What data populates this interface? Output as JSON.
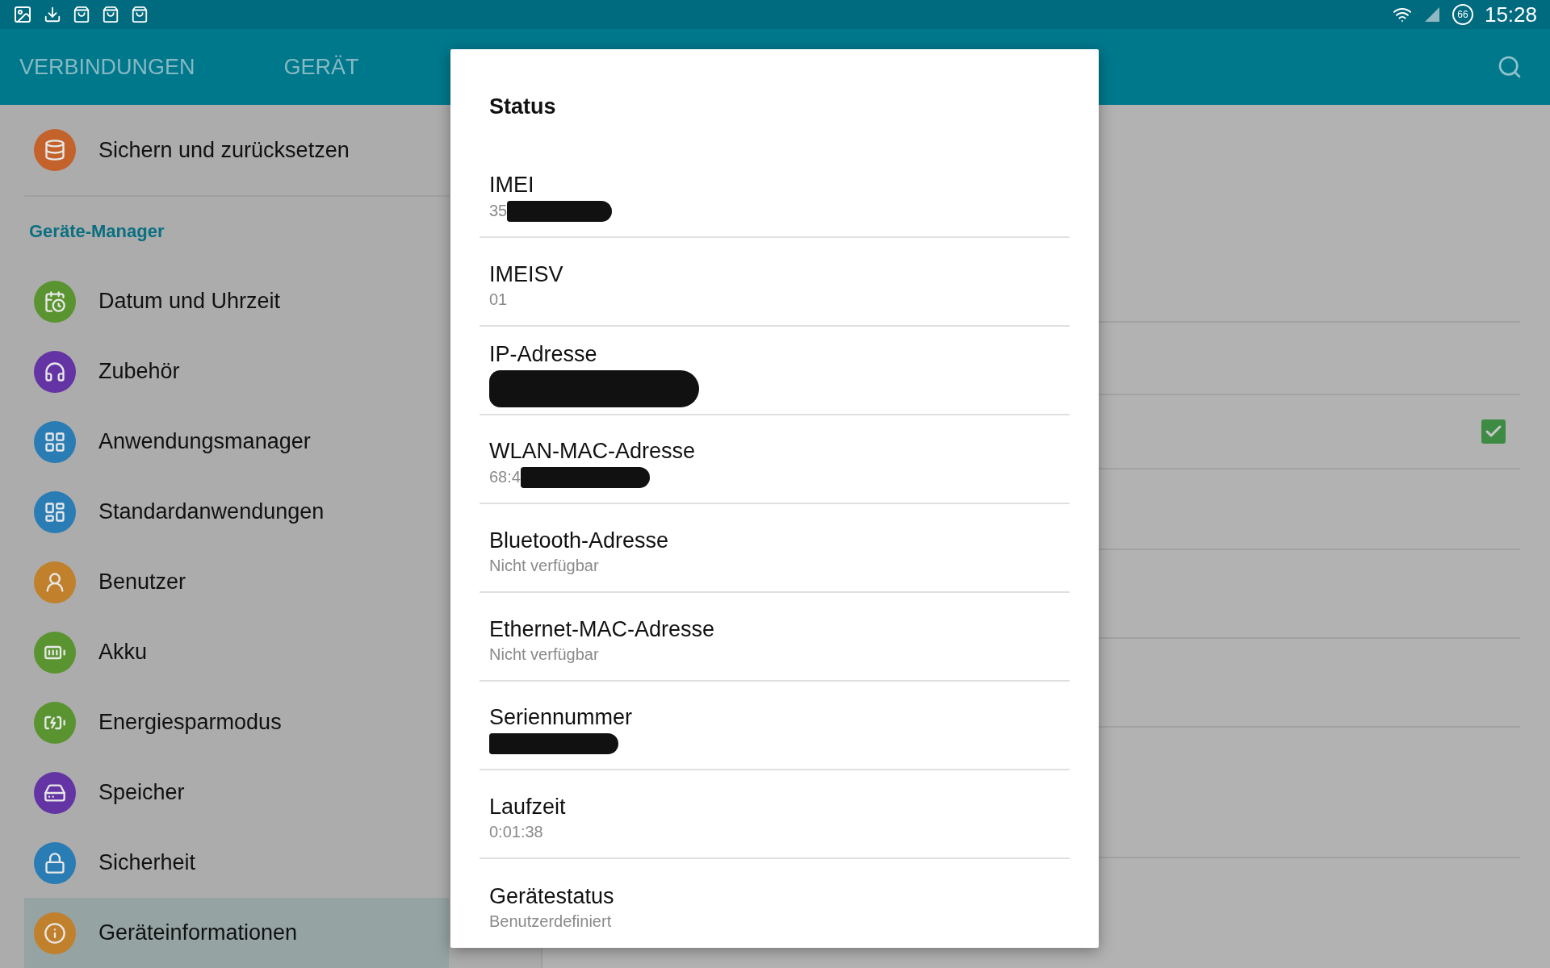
{
  "status_bar": {
    "battery": "66",
    "time": "15:28"
  },
  "tabs": [
    "VERBINDUNGEN",
    "GERÄT"
  ],
  "settings_list": [
    {
      "kind": "item",
      "label": "Sichern und zurücksetzen",
      "color": "#c4622c",
      "selected": false
    },
    {
      "kind": "header",
      "label": "Geräte-Manager"
    },
    {
      "kind": "item",
      "label": "Datum und Uhrzeit",
      "color": "#5a9430",
      "selected": false
    },
    {
      "kind": "item",
      "label": "Zubehör",
      "color": "#6434a4",
      "selected": false
    },
    {
      "kind": "item",
      "label": "Anwendungsmanager",
      "color": "#2a7cb4",
      "selected": false
    },
    {
      "kind": "item",
      "label": "Standardanwendungen",
      "color": "#2a7cb4",
      "selected": false
    },
    {
      "kind": "item",
      "label": "Benutzer",
      "color": "#c0802c",
      "selected": false
    },
    {
      "kind": "item",
      "label": "Akku",
      "color": "#5a9430",
      "selected": false
    },
    {
      "kind": "item",
      "label": "Energiesparmodus",
      "color": "#5a9430",
      "selected": false
    },
    {
      "kind": "item",
      "label": "Speicher",
      "color": "#6434a4",
      "selected": false
    },
    {
      "kind": "item",
      "label": "Sicherheit",
      "color": "#2a7cb4",
      "selected": false
    },
    {
      "kind": "item",
      "label": "Geräteinformationen",
      "color": "#c0802c",
      "selected": true
    }
  ],
  "settings_checkbox": {
    "checked": true
  },
  "dialog": {
    "title": "Status",
    "rows": [
      {
        "label": "IMEI",
        "value": "35",
        "redacted": true
      },
      {
        "label": "IMEISV",
        "value": "01",
        "redacted": false
      },
      {
        "label": "IP-Adresse",
        "redacted": true,
        "tall": true
      },
      {
        "label": "WLAN-MAC-Adresse",
        "value": "68:4",
        "redacted": true
      },
      {
        "label": "Bluetooth-Adresse",
        "value": "Nicht verfügbar",
        "redacted": false
      },
      {
        "label": "Ethernet-MAC-Adresse",
        "value": "Nicht verfügbar",
        "redacted": false
      },
      {
        "label": "Seriennummer",
        "redacted": true
      },
      {
        "label": "Laufzeit",
        "value": "0:01:38",
        "redacted": false
      },
      {
        "label": "Gerätestatus",
        "value": "Benutzerdefiniert",
        "redacted": false
      }
    ]
  }
}
